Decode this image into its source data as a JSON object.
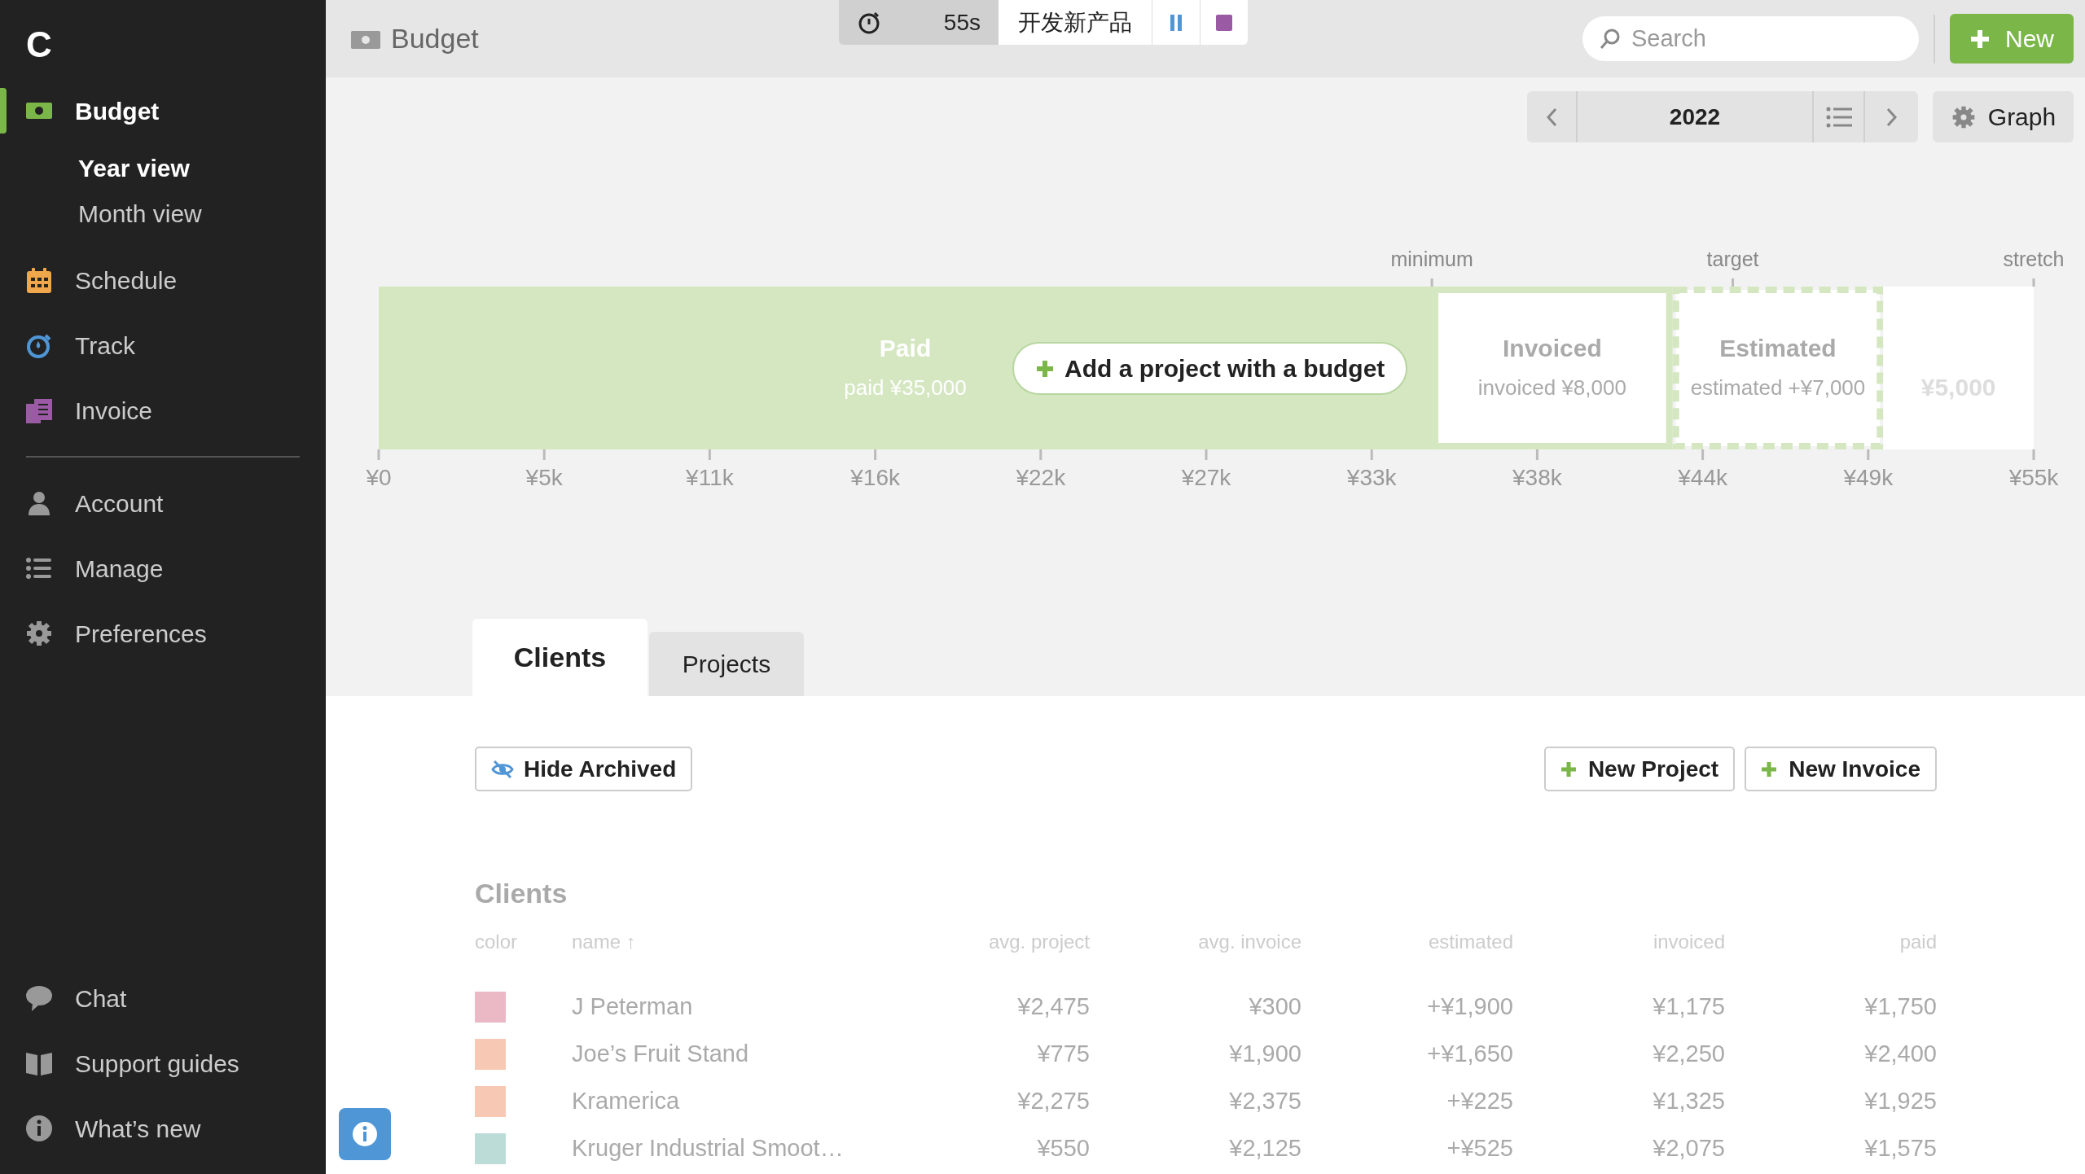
{
  "sidebar": {
    "logo": "C",
    "items": [
      {
        "label": "Budget",
        "selected": true,
        "children": [
          {
            "label": "Year view",
            "selected": true
          },
          {
            "label": "Month view",
            "selected": false
          }
        ]
      },
      {
        "label": "Schedule",
        "selected": false
      },
      {
        "label": "Track",
        "selected": false
      },
      {
        "label": "Invoice",
        "selected": false
      }
    ],
    "secondary": [
      {
        "label": "Account"
      },
      {
        "label": "Manage"
      },
      {
        "label": "Preferences"
      }
    ],
    "footer": [
      {
        "label": "Chat"
      },
      {
        "label": "Support guides"
      },
      {
        "label": "What’s new"
      }
    ]
  },
  "header": {
    "title": "Budget",
    "timer": {
      "elapsed": "55s",
      "task": "开发新产品"
    },
    "search": {
      "placeholder": "Search"
    },
    "new_button": "New"
  },
  "toolbar": {
    "year": "2022",
    "graph_button": "Graph"
  },
  "budget_chart": {
    "add_button": "Add a project with a budget",
    "markers": [
      {
        "label": "minimum",
        "level": 0.6364
      },
      {
        "label": "target",
        "level": 0.8182
      },
      {
        "label": "stretch",
        "level": 1
      }
    ],
    "chart_data": {
      "type": "bar",
      "orientation": "horizontal",
      "stacked": true,
      "series": [
        {
          "name": "Paid",
          "color": "#d4e7c1",
          "values": [
            35000
          ]
        },
        {
          "name": "Invoiced",
          "color": "#d4e7c1",
          "values": [
            8000
          ]
        },
        {
          "name": "Estimated",
          "color": "#d4e7c1",
          "values": [
            7000
          ]
        },
        {
          "name": "¥5,000",
          "color": "#ffffff",
          "values": [
            5000
          ]
        }
      ],
      "value_labels": [
        "paid ¥35,000",
        "invoiced ¥8,000",
        "estimated +¥7,000"
      ],
      "xlim": [
        0,
        55000
      ],
      "xticks": [
        {
          "value": 0,
          "label": "¥0"
        },
        {
          "value": 5500,
          "label": "¥5k"
        },
        {
          "value": 11000,
          "label": "¥11k"
        },
        {
          "value": 16500,
          "label": "¥16k"
        },
        {
          "value": 22000,
          "label": "¥22k"
        },
        {
          "value": 27500,
          "label": "¥27k"
        },
        {
          "value": 33000,
          "label": "¥33k"
        },
        {
          "value": 38500,
          "label": "¥38k"
        },
        {
          "value": 44000,
          "label": "¥44k"
        },
        {
          "value": 49500,
          "label": "¥49k"
        },
        {
          "value": 55000,
          "label": "¥55k"
        }
      ]
    }
  },
  "tabs": [
    {
      "label": "Clients",
      "selected": true
    },
    {
      "label": "Projects",
      "selected": false
    }
  ],
  "actions": {
    "hide_archived": "Hide Archived",
    "new_project": "New Project",
    "new_invoice": "New Invoice"
  },
  "clients": {
    "title": "Clients",
    "columns": [
      "color",
      "name ↑",
      "avg. project",
      "avg. invoice",
      "estimated",
      "invoiced",
      "paid"
    ],
    "rows": [
      {
        "color": "#ebb8c6",
        "name": "J Peterman",
        "avg_project": "¥2,475",
        "avg_invoice": "¥300",
        "estimated": "+¥1,900",
        "invoiced": "¥1,175",
        "paid": "¥1,750"
      },
      {
        "color": "#f7c9b4",
        "name": "Joe’s Fruit Stand",
        "avg_project": "¥775",
        "avg_invoice": "¥1,900",
        "estimated": "+¥1,650",
        "invoiced": "¥2,250",
        "paid": "¥2,400"
      },
      {
        "color": "#f7c9b4",
        "name": "Kramerica",
        "avg_project": "¥2,275",
        "avg_invoice": "¥2,375",
        "estimated": "+¥225",
        "invoiced": "¥1,325",
        "paid": "¥1,925"
      },
      {
        "color": "#bcdcd8",
        "name": "Kruger Industrial Smoot…",
        "avg_project": "¥550",
        "avg_invoice": "¥2,125",
        "estimated": "+¥525",
        "invoiced": "¥2,075",
        "paid": "¥1,575"
      }
    ]
  }
}
